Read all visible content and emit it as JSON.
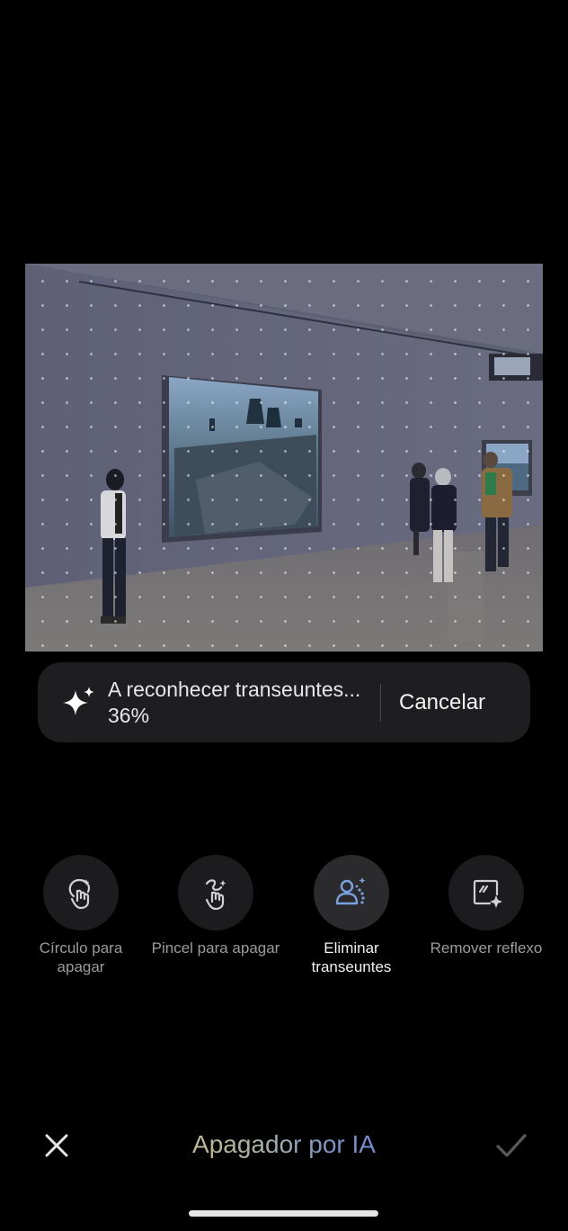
{
  "progress": {
    "text": "A reconhecer transeuntes... 36%",
    "percent": 36,
    "cancel_label": "Cancelar"
  },
  "tools": [
    {
      "label": "Círculo para apagar",
      "icon": "circle-erase-icon",
      "active": false
    },
    {
      "label": "Pincel para apagar",
      "icon": "brush-erase-icon",
      "active": false
    },
    {
      "label": "Eliminar transeuntes",
      "icon": "remove-passersby-icon",
      "active": true
    },
    {
      "label": "Remover reflexo",
      "icon": "remove-reflection-icon",
      "active": false
    }
  ],
  "bottom_bar": {
    "title": "Apagador por IA",
    "close_icon": "close-icon",
    "confirm_icon": "check-icon"
  },
  "colors": {
    "background": "#000000",
    "pill_bg": "#1e1e20",
    "tool_circle_bg": "#1c1c1e",
    "accent_blue": "#6d86d4",
    "active_icon": "#7aa2e0"
  }
}
